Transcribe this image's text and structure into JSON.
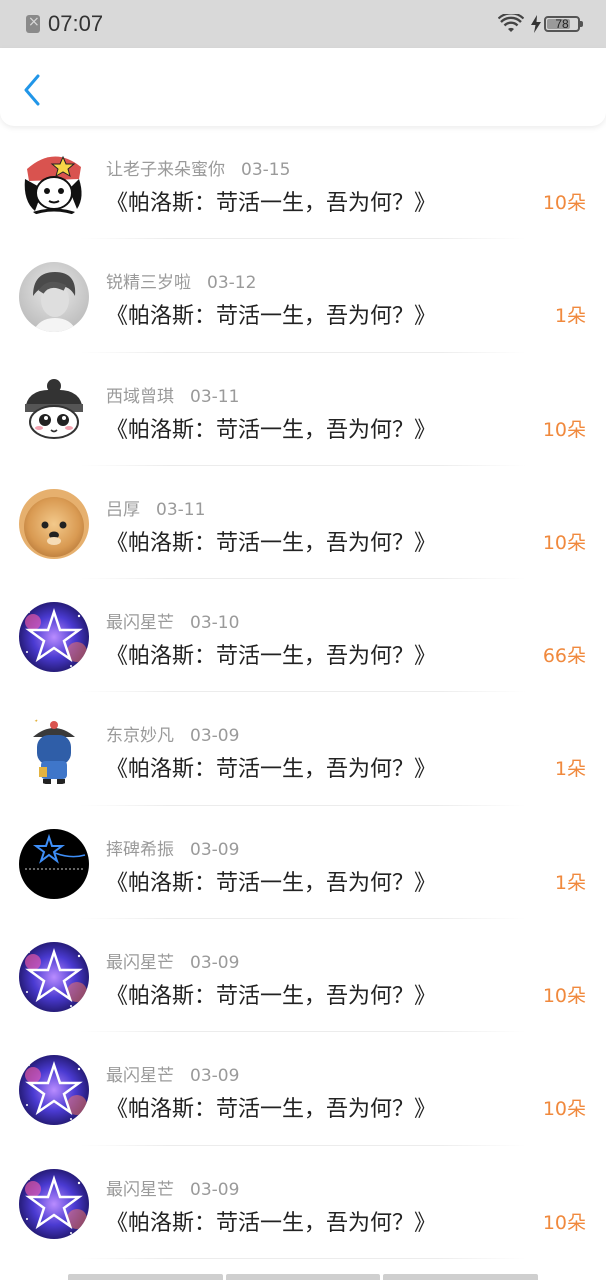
{
  "status_bar": {
    "time": "07:07",
    "battery_level": "78",
    "icons": [
      "sim-off-icon",
      "wifi-icon",
      "charging-bolt-icon",
      "battery-icon"
    ]
  },
  "nav": {
    "back_icon": "chevron-left-icon",
    "accent": "#2196e8"
  },
  "colors": {
    "amount": "#f0893d",
    "username": "#9a9a9a",
    "title": "#222222"
  },
  "rows": [
    {
      "username": "让老子来朵蜜你",
      "date": "03-15",
      "title": "《帕洛斯：苛活一生，吾为何？》",
      "amount": "10朵",
      "avatar": "cartoon-girl-avatar"
    },
    {
      "username": "锐精三岁啦",
      "date": "03-12",
      "title": "《帕洛斯：苛活一生，吾为何？》",
      "amount": "1朵",
      "avatar": "grayscale-portrait-avatar"
    },
    {
      "username": "西域曾琪",
      "date": "03-11",
      "title": "《帕洛斯：苛活一生，吾为何？》",
      "amount": "10朵",
      "avatar": "cartoon-ninja-avatar"
    },
    {
      "username": "吕厚",
      "date": "03-11",
      "title": "《帕洛斯：苛活一生，吾为何？》",
      "amount": "10朵",
      "avatar": "pomeranian-dog-avatar"
    },
    {
      "username": "最闪星芒",
      "date": "03-10",
      "title": "《帕洛斯：苛活一生，吾为何？》",
      "amount": "66朵",
      "avatar": "galaxy-star-avatar"
    },
    {
      "username": "东京妙凡",
      "date": "03-09",
      "title": "《帕洛斯：苛活一生，吾为何？》",
      "amount": "1朵",
      "avatar": "qing-official-avatar"
    },
    {
      "username": "摔碑希振",
      "date": "03-09",
      "title": "《帕洛斯：苛活一生，吾为何？》",
      "amount": "1朵",
      "avatar": "shooting-star-avatar"
    },
    {
      "username": "最闪星芒",
      "date": "03-09",
      "title": "《帕洛斯：苛活一生，吾为何？》",
      "amount": "10朵",
      "avatar": "galaxy-star-avatar"
    },
    {
      "username": "最闪星芒",
      "date": "03-09",
      "title": "《帕洛斯：苛活一生，吾为何？》",
      "amount": "10朵",
      "avatar": "galaxy-star-avatar"
    },
    {
      "username": "最闪星芒",
      "date": "03-09",
      "title": "《帕洛斯：苛活一生，吾为何？》",
      "amount": "10朵",
      "avatar": "galaxy-star-avatar"
    }
  ]
}
